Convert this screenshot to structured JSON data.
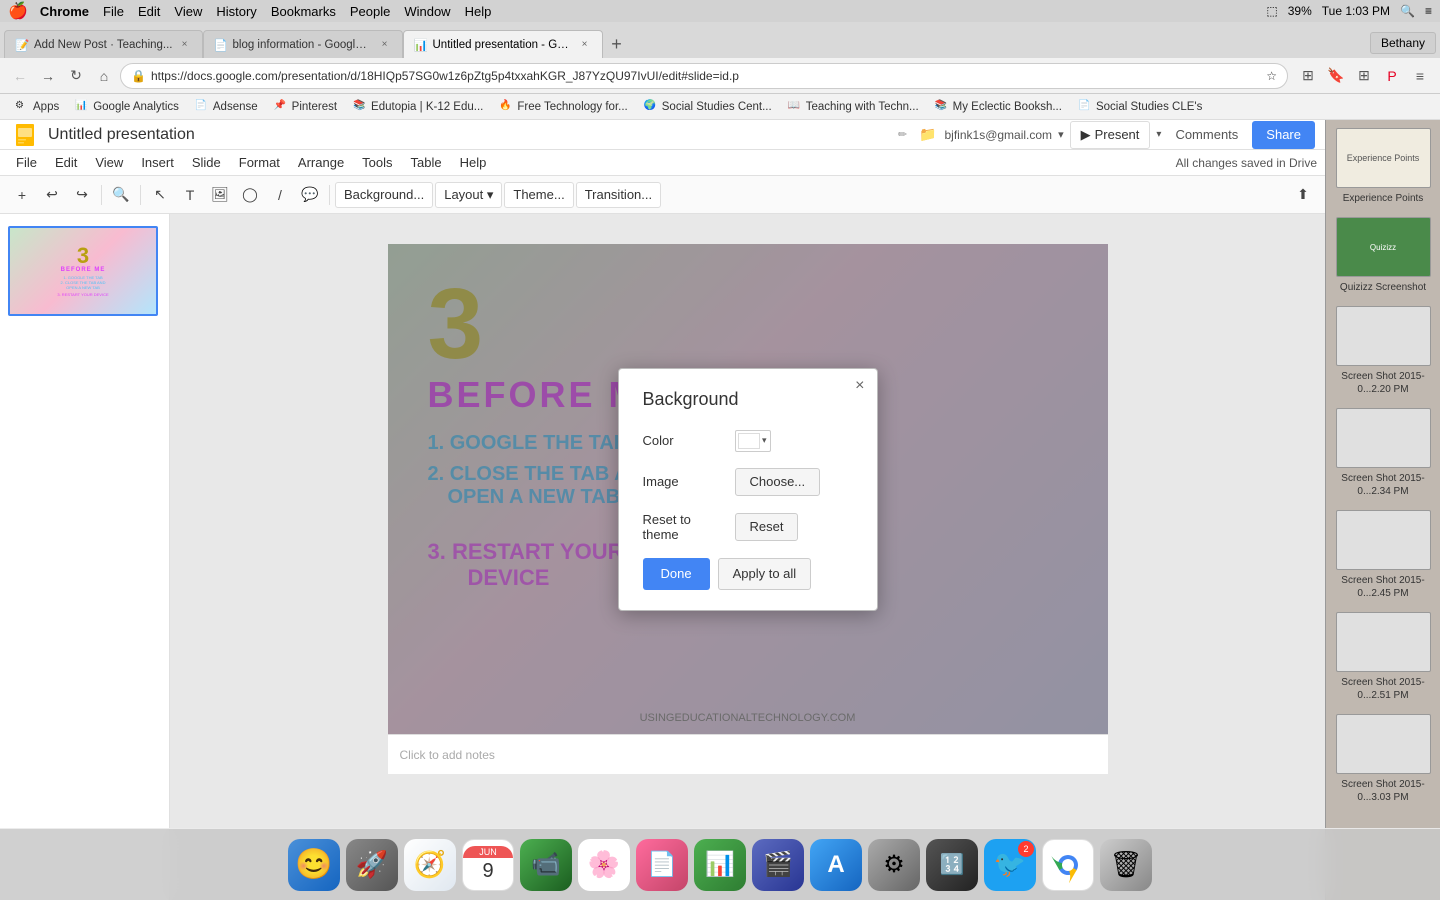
{
  "macMenuBar": {
    "apple": "🍎",
    "items": [
      "Chrome",
      "File",
      "Edit",
      "View",
      "History",
      "Bookmarks",
      "People",
      "Window",
      "Help"
    ],
    "right": {
      "airplay": "⬜",
      "battery": "39%",
      "time": "Tue 1:03 PM",
      "search": "🔍",
      "notification": "≡"
    }
  },
  "tabs": [
    {
      "id": "tab1",
      "icon": "📝",
      "title": "Add New Post · Teaching...",
      "active": false
    },
    {
      "id": "tab2",
      "icon": "📄",
      "title": "blog information - Google ...",
      "active": false
    },
    {
      "id": "tab3",
      "icon": "📊",
      "title": "Untitled presentation - Go...",
      "active": true
    }
  ],
  "addressBar": {
    "url": "https://docs.google.com/presentation/d/18HIQp57SG0w1z6pZtg5p4txxahKGR_J87YzQU97IvUI/edit#slide=id.p",
    "secure": true
  },
  "bookmarks": [
    {
      "label": "Apps",
      "icon": "⚙"
    },
    {
      "label": "Google Analytics",
      "icon": "📊"
    },
    {
      "label": "Adsense",
      "icon": "📄"
    },
    {
      "label": "Pinterest",
      "icon": "📌"
    },
    {
      "label": "Edutopia | K-12 Edu...",
      "icon": "📚"
    },
    {
      "label": "Free Technology for...",
      "icon": "📰"
    },
    {
      "label": "Social Studies Cent...",
      "icon": "🌍"
    },
    {
      "label": "Teaching with Techn...",
      "icon": "📖"
    },
    {
      "label": "My Eclectic Booksh...",
      "icon": "📚"
    },
    {
      "label": "Social Studies CLE's",
      "icon": "📄"
    }
  ],
  "slidesApp": {
    "title": "Untitled presentation",
    "user": "bjfink1s@gmail.com",
    "menus": [
      "File",
      "Edit",
      "View",
      "Insert",
      "Slide",
      "Format",
      "Arrange",
      "Tools",
      "Table",
      "Help"
    ],
    "savedMsg": "All changes saved in Drive",
    "presentBtn": "Present",
    "commentsBtn": "Comments",
    "shareBtn": "Share",
    "toolbarDropdowns": [
      "Background...",
      "Layout ▾",
      "Theme...",
      "Transition..."
    ],
    "notesPlaceholder": "Click to add notes"
  },
  "dialog": {
    "title": "Background",
    "closeLabel": "×",
    "colorLabel": "Color",
    "imageLabel": "Image",
    "resetLabel": "Reset to theme",
    "chooseBtn": "Choose...",
    "resetBtn": "Reset",
    "doneBtn": "Done",
    "applyBtn": "Apply to all",
    "colorValue": "#ffffff"
  },
  "rightSidebar": {
    "items": [
      {
        "label": "Experience Points",
        "bg": "#f0ece0"
      },
      {
        "label": "Quizizz Screenshot",
        "bg": "#4a8a4a"
      },
      {
        "label": "Screen Shot 2015-0...2.20 PM",
        "bg": "#e8e8e8"
      },
      {
        "label": "Screen Shot 2015-0...2.34 PM",
        "bg": "#e8e8e8"
      },
      {
        "label": "Screen Shot 2015-0...2.45 PM",
        "bg": "#e8e8e8"
      },
      {
        "label": "Screen Shot 2015-0...2.51 PM",
        "bg": "#e8e8e8"
      },
      {
        "label": "Screen Shot 2015-0...3.03 PM",
        "bg": "#e8e8e8"
      }
    ]
  },
  "dock": {
    "items": [
      {
        "name": "finder",
        "icon": "😊",
        "bg": "#4a90d9",
        "badge": null
      },
      {
        "name": "launchpad",
        "icon": "🚀",
        "bg": "#888",
        "badge": null
      },
      {
        "name": "safari",
        "icon": "🧭",
        "bg": "#4a90d9",
        "badge": null
      },
      {
        "name": "calendar",
        "icon": "📅",
        "bg": "#f5f5f5",
        "badge": null
      },
      {
        "name": "facetime",
        "icon": "📱",
        "bg": "#6ac",
        "badge": null
      },
      {
        "name": "photos",
        "icon": "🌸",
        "bg": "#fff",
        "badge": null
      },
      {
        "name": "pages",
        "icon": "📄",
        "bg": "#f5a",
        "badge": null
      },
      {
        "name": "numbers",
        "icon": "📊",
        "bg": "#5a5",
        "badge": null
      },
      {
        "name": "keynote",
        "icon": "📋",
        "bg": "#55a",
        "badge": null
      },
      {
        "name": "appstore",
        "icon": "🅐",
        "bg": "#4a90d9",
        "badge": null
      },
      {
        "name": "settings",
        "icon": "⚙",
        "bg": "#888",
        "badge": null
      },
      {
        "name": "calculator",
        "icon": "🔢",
        "bg": "#555",
        "badge": null
      },
      {
        "name": "twitter",
        "icon": "🐦",
        "bg": "#1da1f2",
        "badge": "2"
      },
      {
        "name": "chrome",
        "icon": "◎",
        "bg": "#fff",
        "badge": null
      },
      {
        "name": "trash",
        "icon": "🗑",
        "bg": "#888",
        "badge": null
      }
    ]
  }
}
